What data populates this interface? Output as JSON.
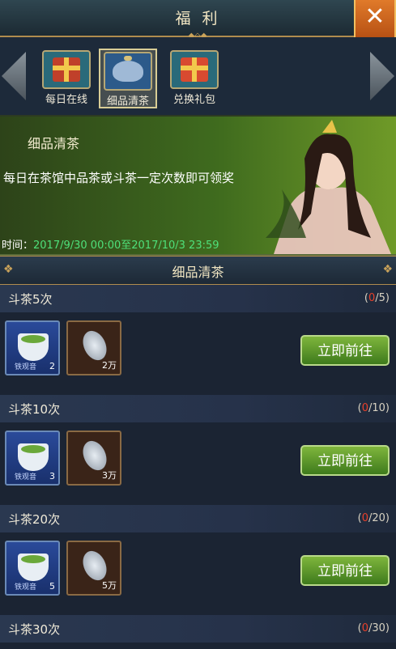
{
  "header": {
    "title": "福 利",
    "close_icon": "close-icon"
  },
  "tabs": [
    {
      "label": "每日在线",
      "icon": "gift-box-icon",
      "active": false
    },
    {
      "label": "细品清茶",
      "icon": "teapot-icon",
      "active": true
    },
    {
      "label": "兑换礼包",
      "icon": "gift-bag-icon",
      "active": false
    }
  ],
  "banner": {
    "name": "细品清茶",
    "description": "每日在茶馆中品茶或斗茶一定次数即可领奖",
    "time_label": "时间：",
    "time_value": "2017/9/30 00:00至2017/10/3 23:59"
  },
  "section": {
    "title": "细品清茶"
  },
  "tasks": [
    {
      "title": "斗茶5次",
      "current": "0",
      "total": "/5)",
      "open": "(",
      "tea_count": "2",
      "coin_count": "2万",
      "button": "立即前往"
    },
    {
      "title": "斗茶10次",
      "current": "0",
      "total": "/10)",
      "open": "(",
      "tea_count": "3",
      "coin_count": "3万",
      "button": "立即前往"
    },
    {
      "title": "斗茶20次",
      "current": "0",
      "total": "/20)",
      "open": "(",
      "tea_count": "5",
      "coin_count": "5万",
      "button": "立即前往"
    },
    {
      "title": "斗茶30次",
      "current": "0",
      "total": "/30)",
      "open": "("
    }
  ],
  "reward_item_label": "铁观音",
  "colors": {
    "accent_gold": "#b08c4e",
    "button_green": "#5e9a2c",
    "time_green": "#4ee07a",
    "progress_red": "#e8402a"
  }
}
